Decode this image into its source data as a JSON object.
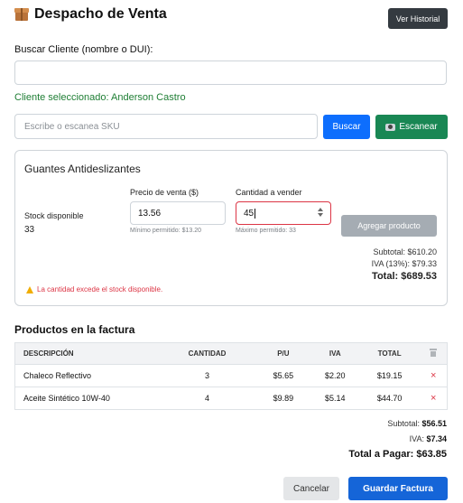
{
  "header": {
    "icon": "package-box-icon",
    "title": "Despacho de Venta",
    "history_button": "Ver Historial"
  },
  "customer_search": {
    "label": "Buscar Cliente (nombre o DUI):",
    "value": "",
    "selected_prefix": "Cliente seleccionado:",
    "selected_name": "Anderson Castro"
  },
  "sku_search": {
    "placeholder": "Escribe o escanea SKU",
    "search_button": "Buscar",
    "scan_button": "Escanear",
    "scan_icon": "camera-icon"
  },
  "product_card": {
    "title": "Guantes Antideslizantes",
    "stock_label": "Stock disponible",
    "stock_value": "33",
    "price_label": "Precio de venta ($)",
    "price_value": "13.56",
    "price_hint": "Mínimo permitido: $13.20",
    "qty_label": "Cantidad a vender",
    "qty_value": "45",
    "qty_hint": "Máximo permitido: 33",
    "add_button": "Agregar producto",
    "subtotal": "Subtotal: $610.20",
    "iva": "IVA (13%): $79.33",
    "total": "Total: $689.53",
    "warning": "La cantidad excede el stock disponible.",
    "warning_icon": "warning-triangle-icon"
  },
  "invoice": {
    "section_title": "Productos en la factura",
    "columns": [
      "DESCRIPCIÓN",
      "CANTIDAD",
      "P/U",
      "IVA",
      "TOTAL"
    ],
    "delete_column_icon": "trash-icon",
    "rows": [
      {
        "descripcion": "Chaleco Reflectivo",
        "cantidad": "3",
        "pu": "$5.65",
        "iva": "$2.20",
        "total": "$19.15",
        "delete_icon": "×"
      },
      {
        "descripcion": "Aceite Sintético 10W-40",
        "cantidad": "4",
        "pu": "$9.89",
        "iva": "$5.14",
        "total": "$44.70",
        "delete_icon": "×"
      }
    ],
    "subtotal_label": "Subtotal:",
    "subtotal_value": "$56.51",
    "iva_label": "IVA:",
    "iva_value": "$7.34",
    "total_label": "Total a Pagar:",
    "total_value": "$63.85"
  },
  "footer": {
    "cancel_button": "Cancelar",
    "save_button": "Guardar Factura"
  },
  "colors": {
    "primary": "#0d6efd",
    "success": "#198754",
    "danger": "#dc3545",
    "dark": "#343a40"
  }
}
